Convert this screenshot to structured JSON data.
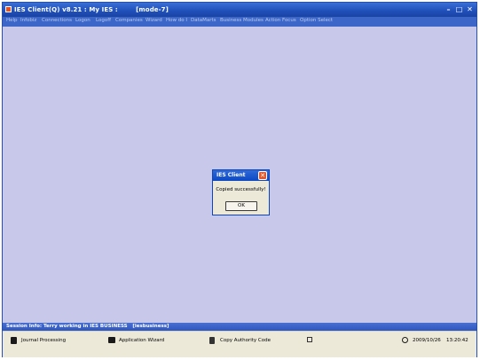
{
  "window": {
    "title": "IES Client(Q) v8.21 : My IES :        [mode-7]",
    "controls": [
      "minimize-icon",
      "maximize-icon",
      "close-icon"
    ]
  },
  "menu": [
    "Help",
    "Infobiz",
    "Connections",
    "Logon",
    "Logoff",
    "Companies",
    "Wizard",
    "How do I",
    "DataMarts",
    "Business Modules",
    "Action Focus",
    "Option Select"
  ],
  "dialog": {
    "title": "IES Client",
    "message": "Copied successfully!",
    "ok_label": "OK"
  },
  "session": {
    "text": "Session Info: Terry working in IES BUSINESS   [iesbusiness]"
  },
  "taskbar": {
    "tasks": [
      {
        "label": "Journal Processing",
        "icon": "document-icon"
      },
      {
        "label": "Application Wizard",
        "icon": "wizard-icon"
      },
      {
        "label": "Copy Authority Code",
        "icon": "copy-icon"
      }
    ],
    "date": "2009/10/26",
    "time": "13:20:42"
  },
  "colors": {
    "workspace": "#c8c8ea",
    "titlebar": "#1f4fb8",
    "taskbar": "#ece9d8"
  }
}
